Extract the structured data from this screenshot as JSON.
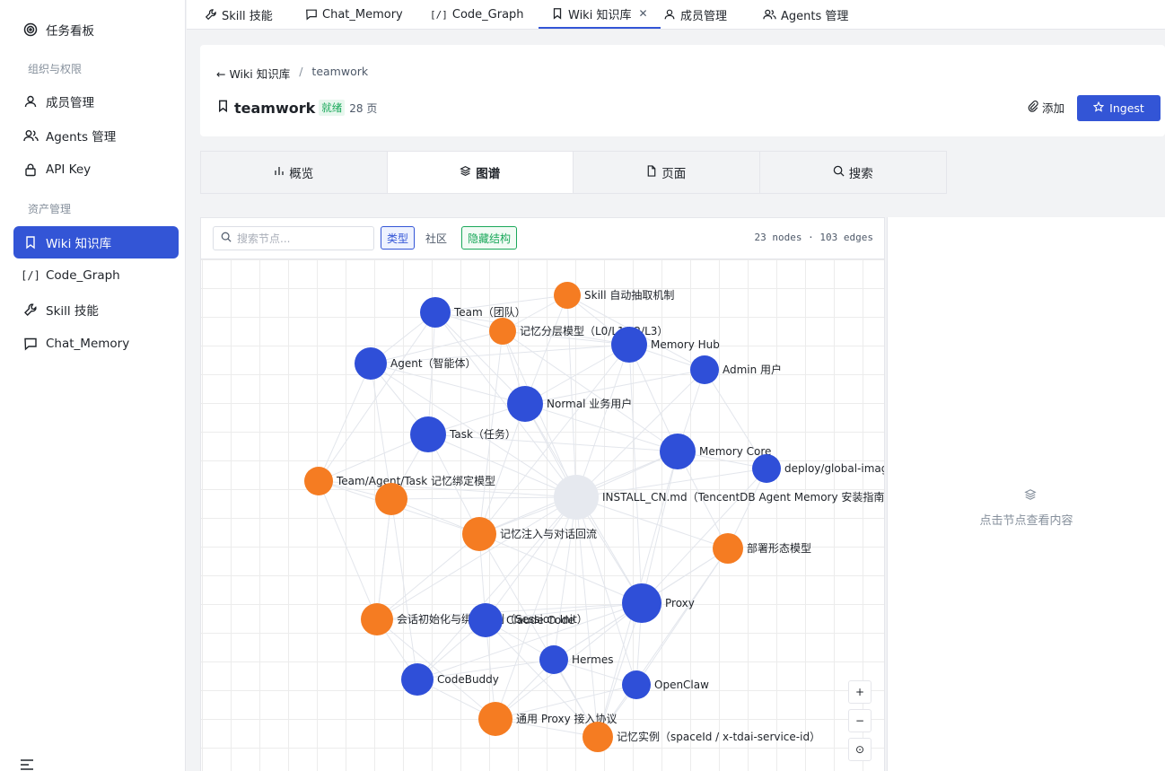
{
  "sidebar": {
    "top_item": "任务看板",
    "section_org": "组织与权限",
    "section_assets": "资产管理",
    "items": [
      {
        "label": "成员管理",
        "icon": "user-icon"
      },
      {
        "label": "Agents 管理",
        "icon": "users-icon"
      },
      {
        "label": "API Key",
        "icon": "lock-icon"
      },
      {
        "label": "Wiki 知识库",
        "icon": "bookmark-icon",
        "active": true
      },
      {
        "label": "Code_Graph",
        "icon": "code-icon"
      },
      {
        "label": "Skill 技能",
        "icon": "wrench-icon"
      },
      {
        "label": "Chat_Memory",
        "icon": "chat-icon"
      }
    ]
  },
  "tabs": [
    {
      "label": "Skill 技能",
      "icon": "wrench-icon"
    },
    {
      "label": "Chat_Memory",
      "icon": "chat-icon"
    },
    {
      "label": "Code_Graph",
      "icon": "code-icon"
    },
    {
      "label": "Wiki 知识库",
      "icon": "bookmark-icon",
      "active": true
    },
    {
      "label": "成员管理",
      "icon": "user-icon"
    },
    {
      "label": "Agents 管理",
      "icon": "users-icon"
    }
  ],
  "header": {
    "back_label": "← Wiki 知识库",
    "separator": "/",
    "crumb_current": "teamwork",
    "title": "teamwork",
    "status": "就绪",
    "page_count": "28 页",
    "add_label": "添加",
    "ingest_label": "Ingest"
  },
  "view_tabs": [
    {
      "label": "概览",
      "icon": "bar-chart-icon"
    },
    {
      "label": "图谱",
      "icon": "layers-icon",
      "active": true
    },
    {
      "label": "页面",
      "icon": "file-icon"
    },
    {
      "label": "搜索",
      "icon": "search-icon"
    }
  ],
  "graph": {
    "search_placeholder": "搜索节点...",
    "chip_type": "类型",
    "chip_community": "社区",
    "chip_hide": "隐藏结构",
    "stats": "23 nodes · 103 edges",
    "zoom_in": "+",
    "zoom_out": "−",
    "zoom_reset": "⊙",
    "colors": {
      "entity": "#2f4fd8",
      "concept": "#f57c22",
      "source": "#e6e9ef",
      "edge": "#e3e6ec"
    },
    "nodes": [
      {
        "id": "skill",
        "label": "Skill 自动抽取机制",
        "kind": "concept"
      },
      {
        "id": "team",
        "label": "Team（团队）",
        "kind": "entity"
      },
      {
        "id": "layers",
        "label": "记忆分层模型（L0/L1/L2/L3）",
        "kind": "concept"
      },
      {
        "id": "hub",
        "label": "Memory Hub",
        "kind": "entity"
      },
      {
        "id": "agent",
        "label": "Agent（智能体）",
        "kind": "entity"
      },
      {
        "id": "admin",
        "label": "Admin 用户",
        "kind": "entity"
      },
      {
        "id": "normal",
        "label": "Normal 业务用户",
        "kind": "entity"
      },
      {
        "id": "task",
        "label": "Task（任务）",
        "kind": "entity"
      },
      {
        "id": "core",
        "label": "Memory Core",
        "kind": "entity"
      },
      {
        "id": "deploy",
        "label": "deploy/global-image",
        "kind": "entity"
      },
      {
        "id": "tat",
        "label": "Team/Agent/Task 记忆绑定模型",
        "kind": "concept"
      },
      {
        "id": "tat2",
        "label": "",
        "kind": "concept"
      },
      {
        "id": "install",
        "label": "INSTALL_CN.md（TencentDB Agent Memory 安装指南）",
        "kind": "source"
      },
      {
        "id": "inject",
        "label": "记忆注入与对话回流",
        "kind": "concept"
      },
      {
        "id": "deployform",
        "label": "部署形态模型",
        "kind": "concept"
      },
      {
        "id": "proxy",
        "label": "Proxy",
        "kind": "entity"
      },
      {
        "id": "session",
        "label": "会话初始化与绑定机制（Session Init）",
        "kind": "concept"
      },
      {
        "id": "claude",
        "label": "Claude Code",
        "kind": "entity"
      },
      {
        "id": "hermes",
        "label": "Hermes",
        "kind": "entity"
      },
      {
        "id": "codebuddy",
        "label": "CodeBuddy",
        "kind": "entity"
      },
      {
        "id": "openclaw",
        "label": "OpenClaw",
        "kind": "entity"
      },
      {
        "id": "proxyproto",
        "label": "通用 Proxy 接入协议",
        "kind": "concept"
      },
      {
        "id": "instance",
        "label": "记忆实例（spaceId / x-tdai-service-id）",
        "kind": "concept"
      }
    ]
  },
  "detail": {
    "hint": "点击节点查看内容"
  }
}
